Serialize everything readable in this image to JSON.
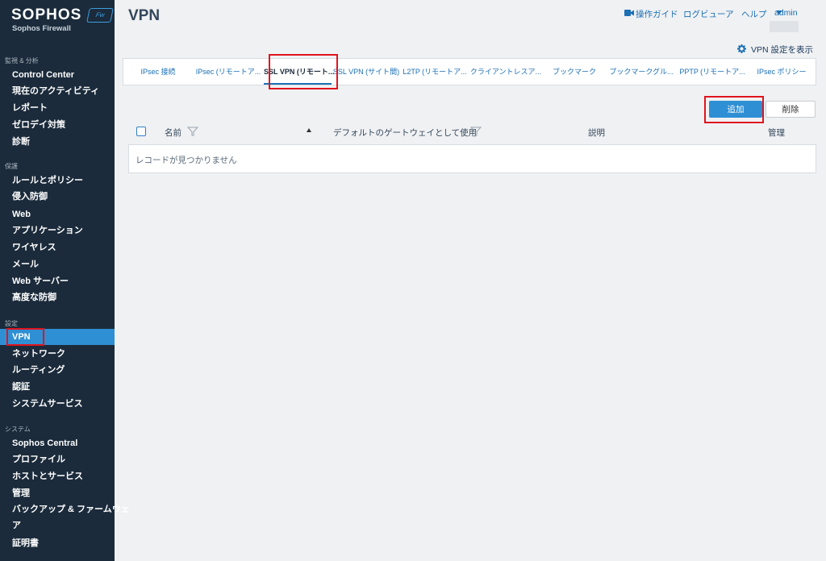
{
  "brand": {
    "name": "SOPHOS",
    "product": "Sophos Firewall",
    "badge": "Fw"
  },
  "sidebar": {
    "sections": [
      {
        "title": "監視 & 分析",
        "items": [
          "Control Center",
          "現在のアクティビティ",
          "レポート",
          "ゼロデイ対策",
          "診断"
        ]
      },
      {
        "title": "保護",
        "items": [
          "ルールとポリシー",
          "侵入防御",
          "Web",
          "アプリケーション",
          "ワイヤレス",
          "メール",
          "Web サーバー",
          "高度な防御"
        ]
      },
      {
        "title": "設定",
        "items": [
          "VPN",
          "ネットワーク",
          "ルーティング",
          "認証",
          "システムサービス"
        ]
      },
      {
        "title": "システム",
        "items": [
          "Sophos Central",
          "プロファイル",
          "ホストとサービス",
          "管理",
          "バックアップ & ファームウェ",
          "ア",
          "証明書"
        ]
      }
    ],
    "active_item": "VPN"
  },
  "header": {
    "title": "VPN",
    "links": {
      "guide": "操作ガイド",
      "log_viewer": "ログビューア",
      "help": "ヘルプ",
      "admin": "admin"
    }
  },
  "vpn_settings_link": "VPN 設定を表示",
  "tabs": [
    {
      "label": "IPsec 接続",
      "active": false
    },
    {
      "label": "IPsec (リモートア...",
      "active": false
    },
    {
      "label": "SSL VPN (リモート...",
      "active": true
    },
    {
      "label": "SSL VPN (サイト間)",
      "active": false
    },
    {
      "label": "L2TP (リモートア...",
      "active": false
    },
    {
      "label": "クライアントレスア...",
      "active": false
    },
    {
      "label": "ブックマーク",
      "active": false
    },
    {
      "label": "ブックマークグル...",
      "active": false
    },
    {
      "label": "PPTP (リモートア...",
      "active": false
    },
    {
      "label": "IPsec ポリシー",
      "active": false
    }
  ],
  "actions": {
    "add": "追加",
    "delete": "削除"
  },
  "table": {
    "columns": [
      "名前",
      "デフォルトのゲートウェイとして使用",
      "説明",
      "管理"
    ],
    "empty_message": "レコードが見つかりません"
  },
  "colors": {
    "sidebar_bg": "#1b2b3b",
    "accent": "#2f8fd4",
    "highlight_box": "#e0141e"
  }
}
